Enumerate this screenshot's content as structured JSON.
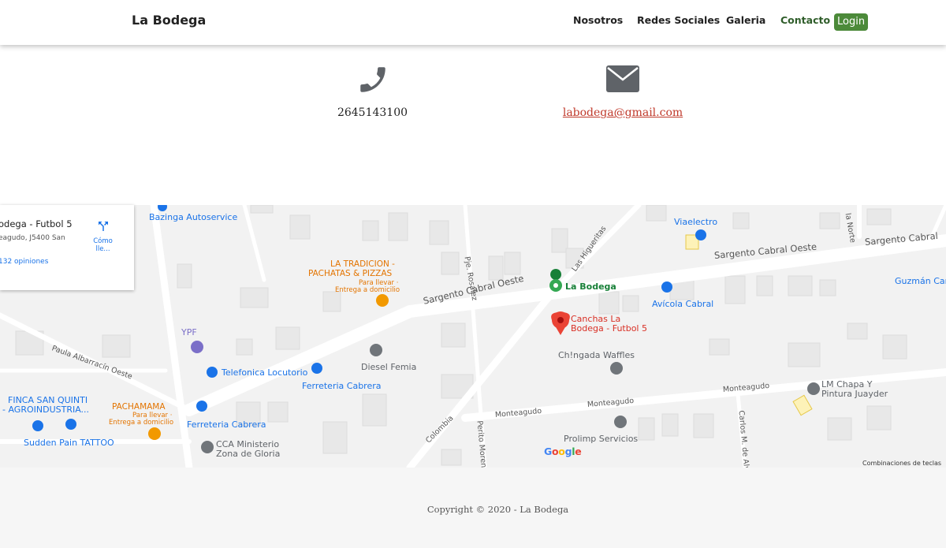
{
  "navbar": {
    "brand": "La Bodega",
    "links": [
      "Nosotros",
      "Redes Sociales",
      "Galeria",
      "Contacto"
    ],
    "login_label": "Login",
    "accent": "#4c8a3a"
  },
  "contact": {
    "phone": "2645143100",
    "email": "labodega@gmail.com",
    "icons": [
      "phone-icon",
      "envelope-icon"
    ]
  },
  "map": {
    "info_card": {
      "title": "odega - Futbol 5",
      "address": "eagudo, J5400 San",
      "reviews": "132 opiniones",
      "directions": "Cómo lle..."
    },
    "places": {
      "bazinga": "Bazinga Autoservice",
      "viaelectro": "Viaelectro",
      "la_tradicion_1": "LA TRADICION -",
      "la_tradicion_2": "PACHATAS & PIZZAS",
      "la_tradicion_sub1": "Para llevar ·",
      "la_tradicion_sub2": "Entrega a domicilio",
      "la_bodega": "La Bodega",
      "avicola": "Avícola Cabral",
      "guzman": "Guzmán Car",
      "canchas_1": "Canchas La",
      "canchas_2": "Bodega - Futbol 5",
      "chingada": "Ch!ngada Waffles",
      "ypf": "YPF",
      "telefonica": "Telefonica Locutorio",
      "diesel": "Diesel Femia",
      "ferreteria_cabrera_1": "Ferreteria Cabrera",
      "ferreteria_cabrera_2": "Ferreteria Cabrera",
      "finca_1": "FINCA SAN QUINTI",
      "finca_2": "- AGROINDUSTRIA...",
      "pachamama": "PACHAMAMA",
      "pachamama_sub1": "Para llevar ·",
      "pachamama_sub2": "Entrega a domicilio",
      "sudden": "Sudden Pain TATTOO",
      "cca_1": "CCA Ministerio",
      "cca_2": "Zona de Gloria",
      "lm_1": "LM Chapa Y",
      "lm_2": "Pintura Juayder",
      "prolimp": "Prolimp Servicios"
    },
    "streets": {
      "sargento_1": "Sargento Cabral Oeste",
      "sargento_2": "Sargento Cabral Oeste",
      "sargento_3": "Sargento Cabral",
      "paula": "Paula Albarracín Oeste",
      "pje_rosalez": "Pje. Rosalez",
      "las_higueritas": "Las Higueritas",
      "colombia": "Colombia",
      "perito_moreno": "Perito Moreno",
      "monteagudo_1": "Monteagudo",
      "monteagudo_2": "Monteagudo",
      "monteagudo_3": "Monteagudo",
      "carlos": "Carlos M. de Alve",
      "la_norte": "la Norte"
    },
    "google_logo": [
      "G",
      "o",
      "o",
      "g",
      "l",
      "e"
    ],
    "google_colors": [
      "#4285f4",
      "#ea4335",
      "#fbbc05",
      "#4285f4",
      "#34a853",
      "#ea4335"
    ],
    "shortcuts": "Combinaciones de teclas"
  },
  "footer": {
    "copyright": "Copyright © 2020 - La Bodega"
  }
}
